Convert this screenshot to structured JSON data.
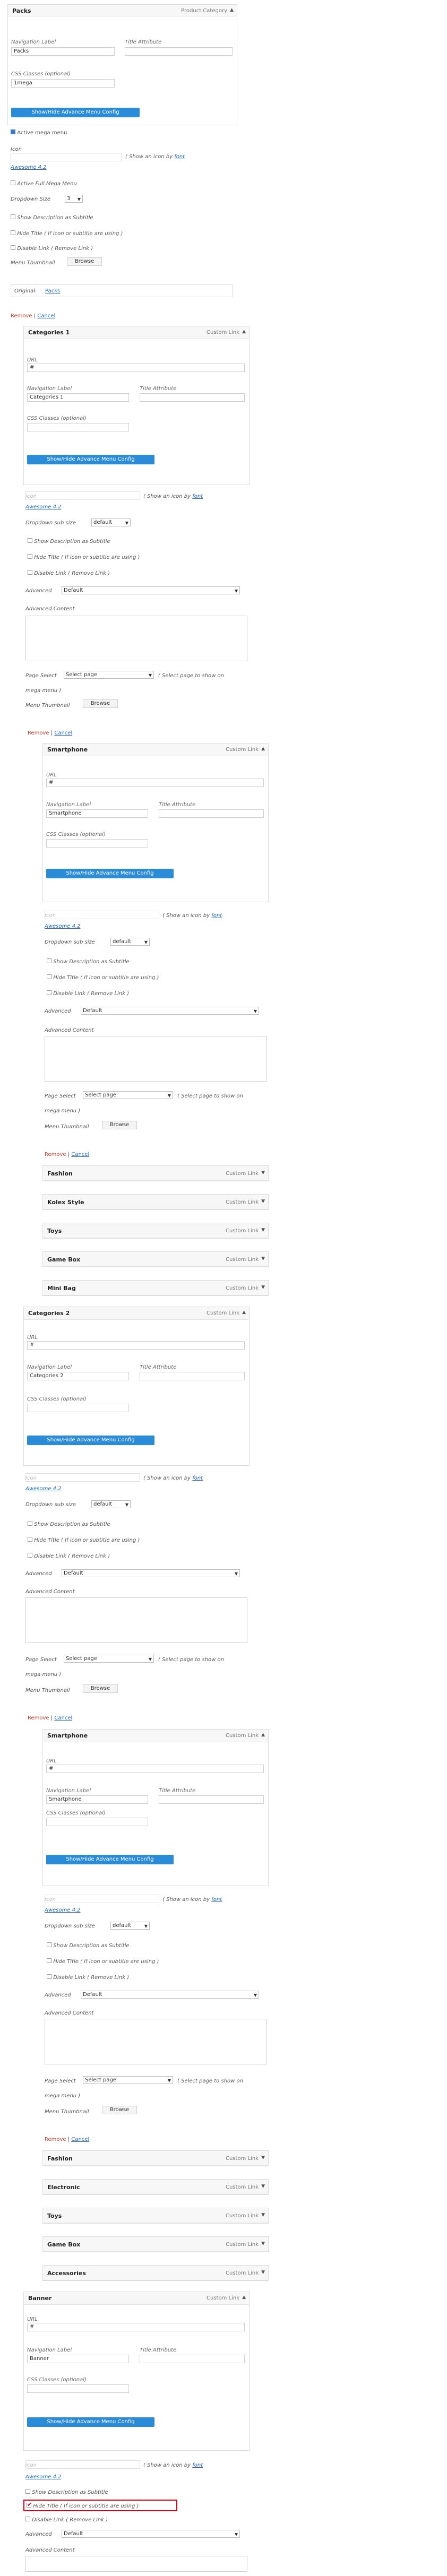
{
  "labels": {
    "navigation_label": "Navigation Label",
    "title_attribute": "Title Attribute",
    "css_classes": "CSS Classes (optional)",
    "url": "URL",
    "advanced_btn": "Show/Hide Advance Menu Config",
    "icon": "Icon",
    "icon_hint_prefix": "( Show an icon by ",
    "icon_hint_link": "font",
    "awesome": "Awesome 4.2",
    "dropdown_sub_size": "Dropdown sub size",
    "dropdown_size": "Dropdown Size",
    "show_desc": "Show Description as Subtitle",
    "hide_title": "Hide Title ( If icon or subtitle are using )",
    "disable_link": "Disable Link ( Remove Link )",
    "advanced": "Advanced",
    "advanced_content": "Advanced Content",
    "page_select": "Page Select",
    "page_select_hint": "( Select page to show on",
    "page_select_hint2": "mega menu )",
    "menu_thumbnail": "Menu Thumbnail",
    "browse": "Browse",
    "remove": "Remove",
    "cancel": "Cancel",
    "sep": "|",
    "custom_link": "Custom Link",
    "product_category": "Product Category",
    "active_mega": "Active mega menu",
    "active_full_mega": "Active Full Mega Menu",
    "original": "Original:",
    "remove_link": "Remove"
  },
  "values": {
    "url": "#",
    "advanced_default": "Default",
    "page_select_default": "Select page",
    "dropdown_default": "default",
    "dropdown_size_value": "3"
  },
  "packs": {
    "title": "Packs",
    "nav_label": "Packs",
    "css_value": "1mega",
    "original_link": "Packs"
  },
  "items": {
    "cat1": {
      "title": "Categories 1",
      "nav": "Categories 1"
    },
    "sp1": {
      "title": "Smartphone",
      "nav": "Smartphone"
    },
    "cat2": {
      "title": "Categories 2",
      "nav": "Categories 2"
    },
    "sp2": {
      "title": "Smartphone",
      "nav": "Smartphone"
    },
    "banner": {
      "title": "Banner",
      "nav": "Banner"
    }
  },
  "group1": [
    "Fashion",
    "Kolex Style",
    "Toys",
    "Game Box",
    "Mini Bag"
  ],
  "group2": [
    "Fashion",
    "Electronic",
    "Toys",
    "Game Box",
    "Accessories"
  ],
  "icons": {
    "expand": "triangle-down",
    "collapse": "triangle-up",
    "check": "check-mark",
    "thumbnail": "backpack-thumbnail"
  }
}
